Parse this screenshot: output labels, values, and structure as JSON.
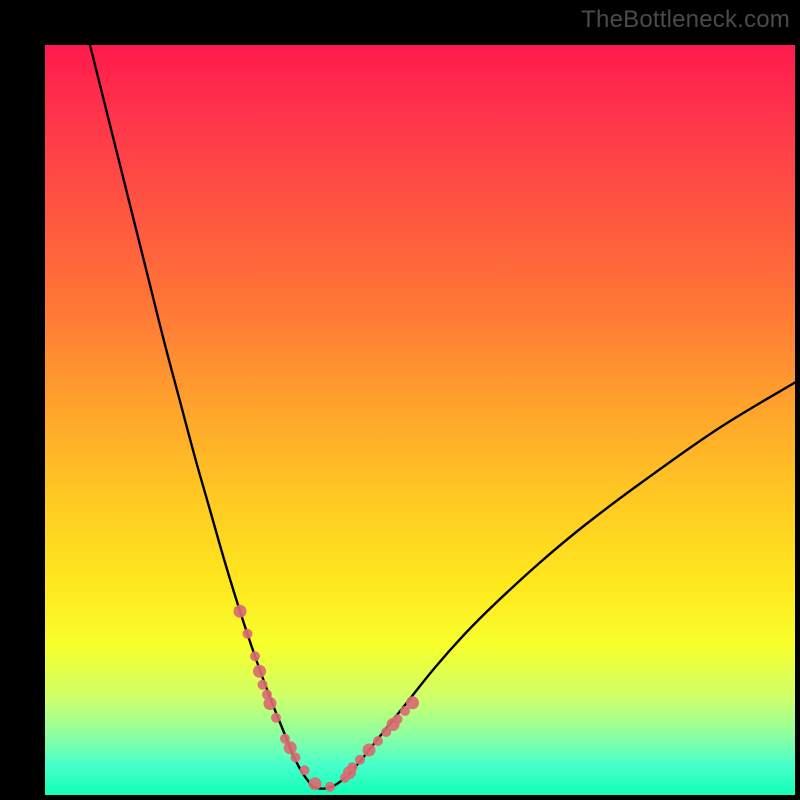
{
  "watermark": "TheBottleneck.com",
  "colors": {
    "curve": "#000000",
    "marker": "#d96b72",
    "frame": "#000000"
  },
  "chart_data": {
    "type": "line",
    "title": "",
    "xlabel": "",
    "ylabel": "",
    "xlim": [
      0,
      100
    ],
    "ylim": [
      0,
      100
    ],
    "grid": false,
    "legend": false,
    "series": [
      {
        "name": "bottleneck-curve",
        "x": [
          6,
          8,
          10,
          12,
          14,
          16,
          18,
          20,
          22,
          24,
          26,
          28,
          30,
          32,
          33,
          34,
          35,
          36,
          38,
          40,
          42,
          44,
          46,
          48,
          52,
          56,
          60,
          66,
          72,
          80,
          90,
          100
        ],
        "y": [
          100,
          92,
          84,
          76,
          68,
          60,
          52.5,
          45,
          38,
          31,
          24.5,
          18.5,
          13,
          8,
          5.5,
          3.5,
          2,
          1,
          1,
          2.3,
          4.5,
          7,
          9.5,
          12,
          17,
          21.5,
          25.5,
          31,
          36,
          42,
          49,
          55
        ]
      }
    ],
    "markers": {
      "name": "highlight-points",
      "x": [
        26,
        27,
        28,
        28.6,
        29,
        29.6,
        30,
        30.8,
        32,
        32.7,
        33.4,
        34.6,
        36,
        38,
        40,
        40.6,
        41,
        42,
        43.2,
        44.4,
        45.5,
        46.4,
        47,
        48,
        49
      ],
      "y": [
        24.5,
        21.5,
        18.5,
        16.5,
        14.7,
        13.4,
        12.2,
        10.3,
        7.5,
        6.3,
        5.0,
        3.3,
        1.5,
        1.1,
        2.3,
        3.0,
        3.7,
        4.7,
        6.0,
        7.2,
        8.4,
        9.4,
        10.1,
        11.2,
        12.3
      ]
    }
  }
}
